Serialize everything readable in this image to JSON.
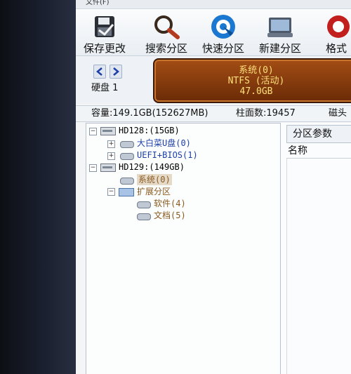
{
  "menubar": {
    "label": "文件(F)"
  },
  "toolbar": {
    "save_label": "保存更改",
    "search_label": "搜索分区",
    "quick_label": "快速分区",
    "new_label": "新建分区",
    "format_label": "格式"
  },
  "disk": {
    "label": "硬盘 1",
    "partition": {
      "name": "系统(0)",
      "fs": "NTFS (活动)",
      "size": "47.0GB"
    }
  },
  "info": {
    "capacity": "容量:149.1GB(152627MB)",
    "cylinders": "柱面数:19457",
    "heads": "磁头"
  },
  "tree": {
    "hd0": "HD128:(15GB)",
    "hd0_p1": "大白菜U盘(0)",
    "hd0_p2": "UEFI+BIOS(1)",
    "hd1": "HD129:(149GB)",
    "hd1_p1": "系统(0)",
    "hd1_ext": "扩展分区",
    "hd1_l1": "软件(4)",
    "hd1_l2": "文档(5)"
  },
  "right": {
    "tab": "分区参数",
    "col_name": "名称"
  },
  "colors": {
    "partition_block": "#8a3c0f",
    "partition_text": "#ffe07a",
    "tree_blue": "#1c3fa8"
  }
}
